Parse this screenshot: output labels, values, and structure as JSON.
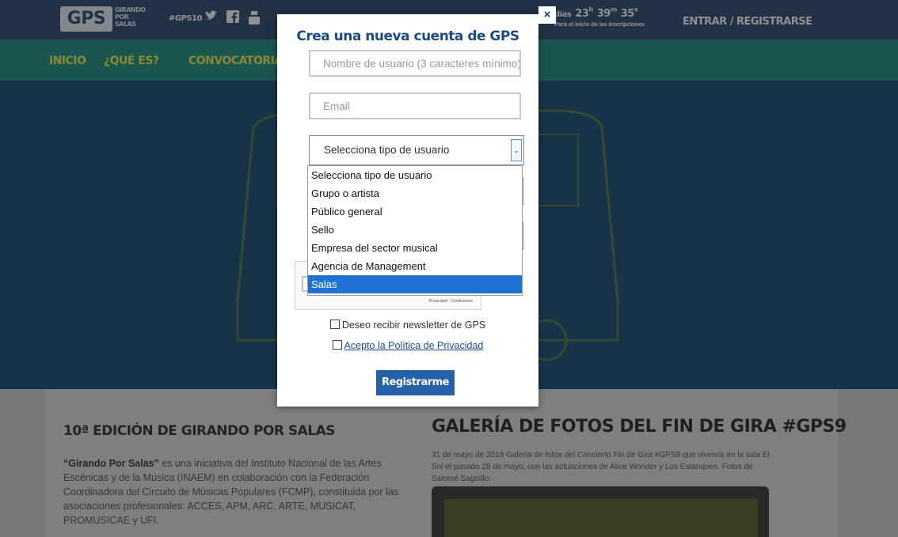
{
  "header": {
    "logo_text": "GPS",
    "logo_sub": [
      "GIRANDO",
      "POR",
      "SALAS"
    ],
    "hashtag": "#GPS10",
    "social_icons": [
      "twitter-icon",
      "facebook-icon",
      "youtube-icon"
    ],
    "countdown_days_label": "días",
    "countdown_hours": "23",
    "countdown_hours_unit": "h",
    "countdown_minutes": "39",
    "countdown_minutes_unit": "m",
    "countdown_seconds": "35",
    "countdown_seconds_unit": "s",
    "countdown_caption": "Para el inicio de las inscripciones",
    "login_label": "ENTRAR / REGISTRARSE"
  },
  "nav": {
    "items": [
      "INICIO",
      "¿QUÉ ES?",
      "CONVOCATORIA"
    ]
  },
  "content": {
    "left_heading": "10ª EDICIÓN DE GIRANDO POR SALAS",
    "left_bold": "“Girando Por Salas”",
    "left_text": " es una iniciativa del Instituto Nacional de las Artes Escénicas y de la Música (INAEM) en colaboración con la Federación Coordinadora del Circuito de Músicas Populares (FCMP), constituida por las asociaciones profesionales: ACCES, APM, ARC, ARTE, MUSICAT, PROMUSICAE y UFI.",
    "right_heading": "GALERÍA DE FOTOS DEL FIN DE GIRA #GPS9",
    "right_text": "31 de mayo de 2019 Galería de fotos del Concierto Fin de Gira #GPS9 que vivimos en la sala El Sol el pasado 28 de mayo, con las actuaciones de Alice Wonder y Los Estanques. Fotos de Salomé Sagüillo:"
  },
  "modal": {
    "close_label": "×",
    "title": "Crea una nueva cuenta de GPS",
    "username_placeholder": "Nombre de usuario (3 caracteres mínimo)",
    "email_placeholder": "Email",
    "select_value": "Selecciona tipo de usuario",
    "options": [
      "Selecciona tipo de usuario",
      "Grupo o artista",
      "Público general",
      "Sello",
      "Empresa del sector musical",
      "Agencia de Management",
      "Salas"
    ],
    "highlighted_option": "Salas",
    "captcha_label": "reCAPTCHA",
    "captcha_links": "Privacidad - Condiciones",
    "newsletter_label": "Deseo recibir newsletter de GPS",
    "privacy_label": "Acepto la Política de Privacidad",
    "submit_label": "Registrarme"
  },
  "colors": {
    "topbar": "#1e3a5f",
    "navbar": "#0f7a6e",
    "accent_blue": "#2560a8",
    "selected_option": "#1e72d4"
  }
}
